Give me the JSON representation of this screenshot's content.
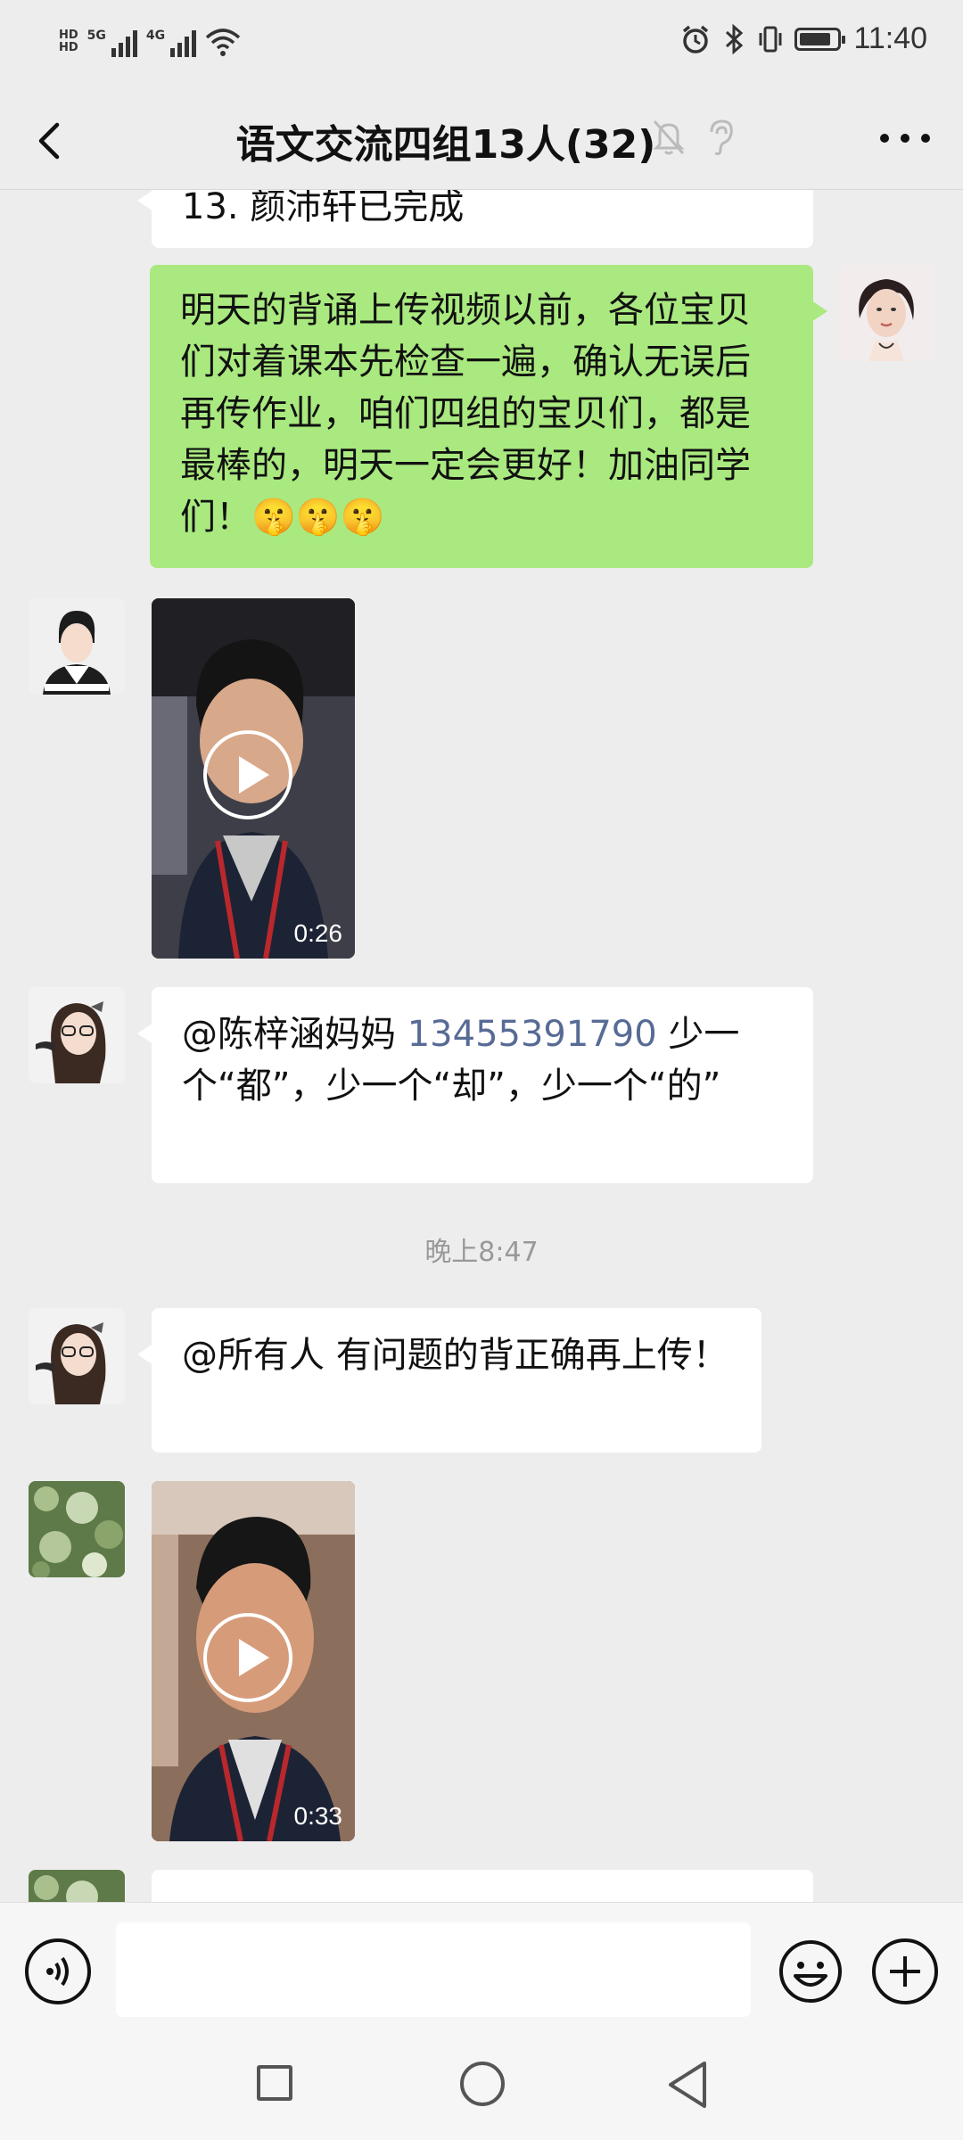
{
  "status_bar": {
    "hd_top": "HD",
    "hd_bottom": "HD",
    "network_1": "5G",
    "network_2": "4G",
    "time": "11:40",
    "icons": [
      "signal-icon",
      "wifi-icon",
      "alarm-icon",
      "bluetooth-icon",
      "vibrate-icon",
      "battery-icon"
    ]
  },
  "header": {
    "title": "语文交流四组13人(32)",
    "back_icon": "chevron-left-icon",
    "mute_icon": "bell-muted-icon",
    "earpiece_icon": "ear-icon",
    "more_icon": "more-horizontal-icon"
  },
  "messages": [
    {
      "type": "text",
      "side": "left",
      "text": "13. 颜沛轩已完成",
      "partial": true
    },
    {
      "type": "text",
      "side": "right",
      "sender": "teacher",
      "text": "明天的背诵上传视频以前，各位宝贝们对着课本先检查一遍，确认无误后再传作业，咱们四组的宝贝们，都是最棒的，明天一定会更好！加油同学们！",
      "emoji": "🤫🤫🤫"
    },
    {
      "type": "video",
      "side": "left",
      "duration": "0:26"
    },
    {
      "type": "text",
      "side": "left",
      "mention": "@陈梓涵妈妈",
      "mention_number": "13455391790",
      "text_after": "  少一个“都”，少一个“却”，少一个“的”"
    },
    {
      "type": "timestamp",
      "text": "晚上8:47"
    },
    {
      "type": "text",
      "side": "left",
      "text": "@所有人  有问题的背正确再上传！"
    },
    {
      "type": "video",
      "side": "left",
      "duration": "0:33"
    },
    {
      "type": "text",
      "side": "left",
      "text": "",
      "partial": true
    }
  ],
  "input_bar": {
    "voice_icon": "voice-icon",
    "text_value": "",
    "emoji_icon": "emoji-icon",
    "add_icon": "plus-icon"
  },
  "nav_bar": {
    "recent_icon": "square-icon",
    "home_icon": "circle-icon",
    "back_icon": "triangle-back-icon"
  },
  "colors": {
    "background": "#ededed",
    "green_bubble": "#a9e97f",
    "white_bubble": "#ffffff",
    "mention_link": "#576b95"
  }
}
